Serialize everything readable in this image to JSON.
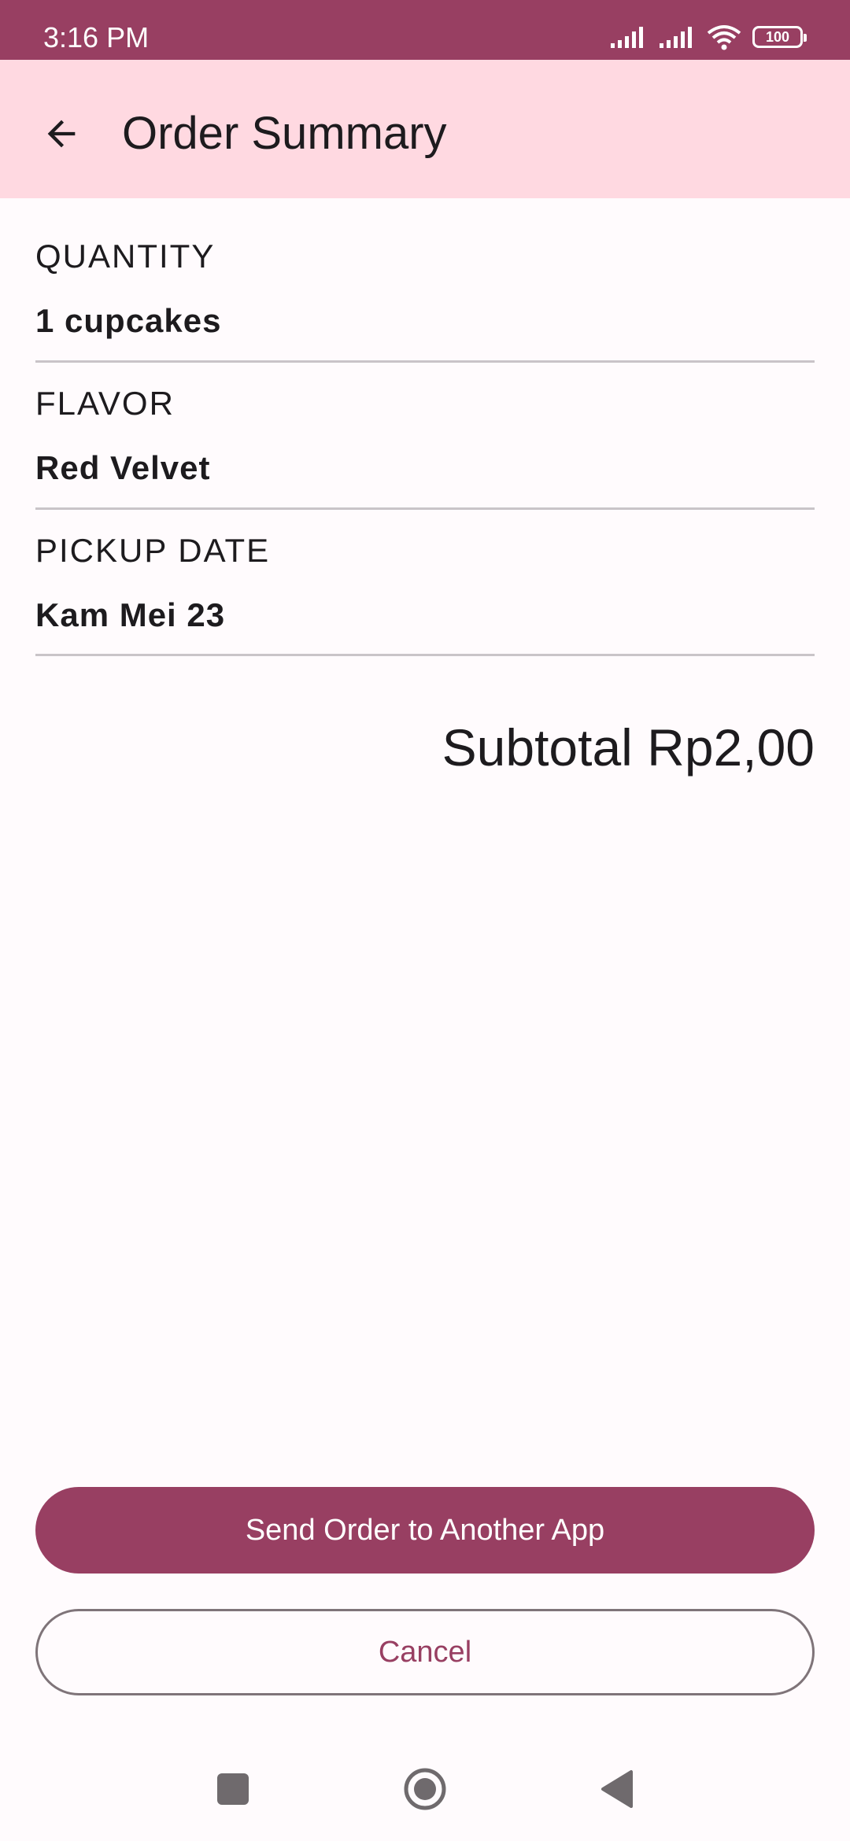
{
  "status_bar": {
    "time": "3:16 PM",
    "battery": "100",
    "icons": [
      "signal-icon",
      "signal-icon",
      "wifi-icon",
      "battery-icon"
    ]
  },
  "app_bar": {
    "title": "Order Summary",
    "back_icon": "arrow-back-icon"
  },
  "summary": {
    "quantity_label": "QUANTITY",
    "quantity_value": "1 cupcakes",
    "flavor_label": "FLAVOR",
    "flavor_value": "Red Velvet",
    "pickup_label": "PICKUP DATE",
    "pickup_value": "Kam Mei 23",
    "subtotal": "Subtotal Rp2,00"
  },
  "actions": {
    "send_label": "Send Order to Another App",
    "cancel_label": "Cancel"
  },
  "nav_bar": {
    "icons": [
      "recents-icon",
      "home-icon",
      "back-icon"
    ]
  },
  "colors": {
    "primary": "#983f62",
    "app_bar_bg": "#ffd9e1",
    "background": "#fffbfd",
    "divider": "#c9c4c8"
  }
}
